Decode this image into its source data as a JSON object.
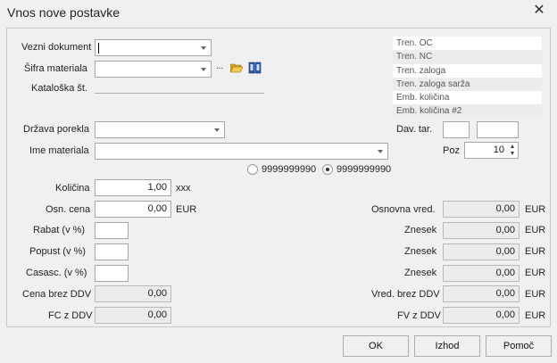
{
  "window": {
    "title": "Vnos nove postavke",
    "close_glyph": "✕"
  },
  "form": {
    "vezni_dokument_label": "Vezni dokument",
    "sifra_materiala_label": "Šifra materiala",
    "sifra_ellipsis": "...",
    "kataloska_label": "Kataloška št.",
    "drzava_label": "Država porekla",
    "ime_label": "Ime materiala",
    "dav_tar_label": "Dav. tar.",
    "poz_label": "Poz",
    "poz_value": "10",
    "radio1_label": "9999999990",
    "radio2_label": "9999999990",
    "kolicina_label": "Količina",
    "kolicina_value": "1,00",
    "kolicina_unit": "xxx",
    "osn_cena_label": "Osn. cena",
    "osn_cena_value": "0,00",
    "osn_cena_unit": "EUR",
    "rabat_label": "Rabat (v %)",
    "popust_label": "Popust (v %)",
    "casasc_label": "Casasc. (v %)",
    "cena_brez_label": "Cena brez DDV",
    "cena_brez_value": "0,00",
    "fc_label": "FC z DDV",
    "fc_value": "0,00",
    "osnovna_vred_label": "Osnovna vred.",
    "osnovna_vred_value": "0,00",
    "znesek1_label": "Znesek",
    "znesek1_value": "0,00",
    "znesek2_label": "Znesek",
    "znesek2_value": "0,00",
    "znesek3_label": "Znesek",
    "znesek3_value": "0,00",
    "vred_brez_label": "Vred. brez DDV",
    "vred_brez_value": "0,00",
    "fv_label": "FV z DDV",
    "fv_value": "0,00",
    "eur": "EUR"
  },
  "info_panel": {
    "rows": [
      "Tren. OC",
      "Tren. NC",
      "Tren. zaloga",
      "Tren. zaloga sarža",
      "Emb. količina",
      "Emb. količina #2"
    ]
  },
  "buttons": {
    "ok": "OK",
    "izhod": "Izhod",
    "pomoc": "Pomoč"
  },
  "icons": {
    "folder": "open-folder-icon",
    "book": "book-icon"
  }
}
